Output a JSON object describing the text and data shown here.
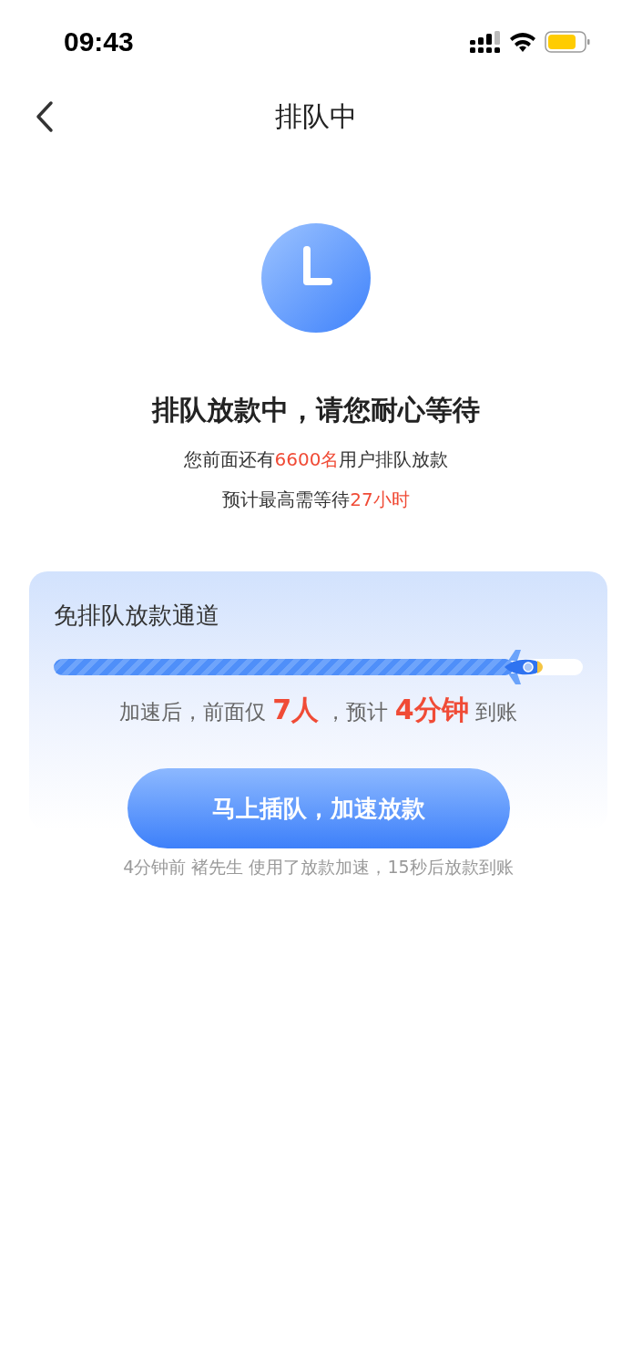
{
  "status_bar": {
    "time": "09:43"
  },
  "nav": {
    "title": "排队中"
  },
  "queue": {
    "heading": "排队放款中，请您耐心等待",
    "lines": [
      [
        {
          "text": "您前面还有",
          "highlight": false
        },
        {
          "text": "6600名",
          "highlight": true
        },
        {
          "text": "用户排队放款",
          "highlight": false
        }
      ],
      [
        {
          "text": "预计最高需等待",
          "highlight": false
        },
        {
          "text": "27小时",
          "highlight": true
        }
      ]
    ]
  },
  "fast_lane": {
    "title": "免排队放款通道",
    "level": 0.87,
    "summary": [
      {
        "text": "加速后，前面仅 ",
        "highlight": false
      },
      {
        "text": "7人",
        "highlight": true
      },
      {
        "text": " ，预计 ",
        "highlight": false
      },
      {
        "text": "4分钟",
        "highlight": true
      },
      {
        "text": " 到账",
        "highlight": false
      }
    ],
    "button": "马上插队，加速放款"
  },
  "notice": "4分钟前 褚先生 使用了放款加速，15秒后放款到账"
}
